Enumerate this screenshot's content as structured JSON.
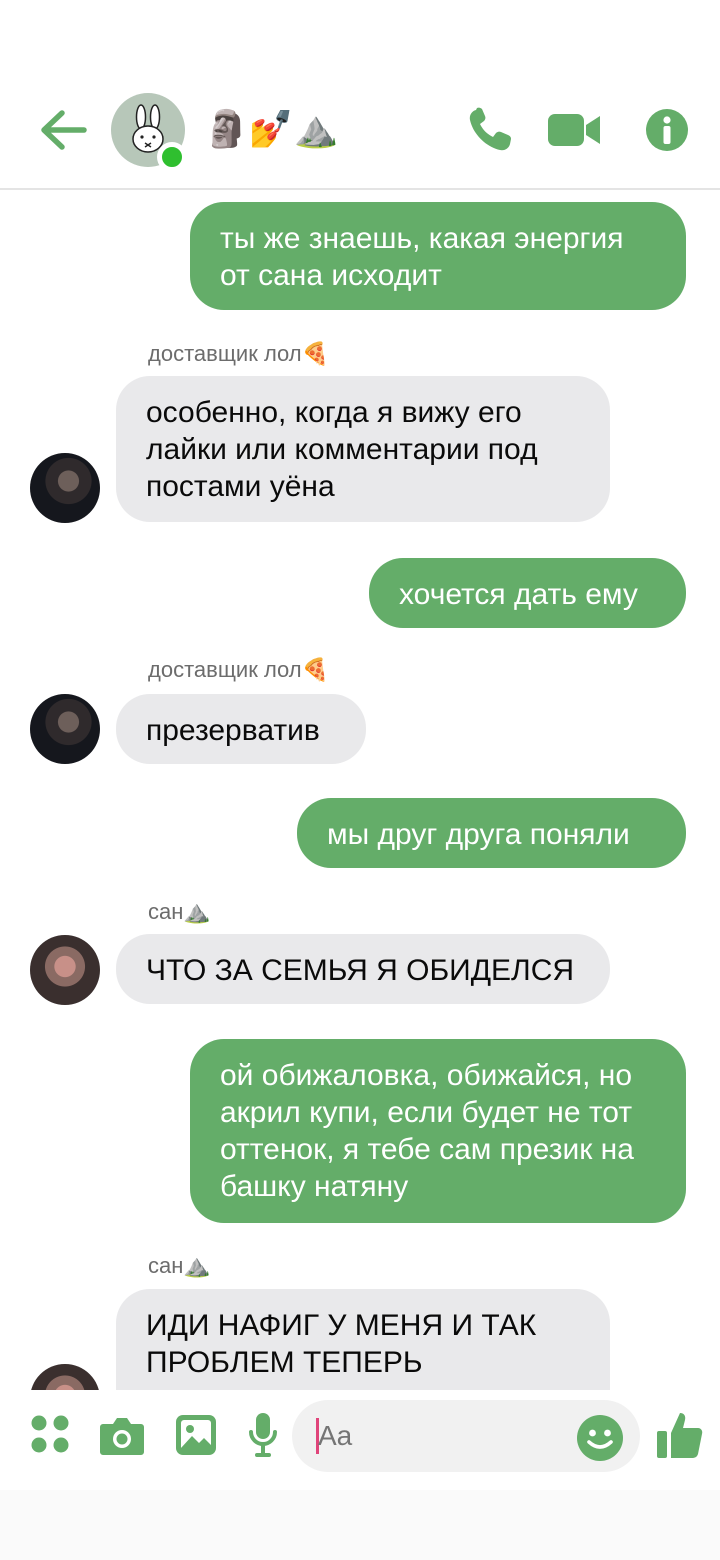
{
  "header": {
    "title": "🗿💅⛰️",
    "back_icon": "arrow-left-icon",
    "call_icon": "phone-icon",
    "video_icon": "video-camera-icon",
    "info_icon": "info-icon",
    "accent_color": "#64ad69"
  },
  "messages": [
    {
      "type": "outgoing",
      "text": "ты же знаешь, какая энергия от сана исходит"
    },
    {
      "type": "incoming",
      "sender": "доставщик лол🍕",
      "text": "особенно, когда я вижу его лайки или комментарии под постами уёна"
    },
    {
      "type": "outgoing",
      "text": "хочется дать ему"
    },
    {
      "type": "incoming",
      "sender": "доставщик лол🍕",
      "text": "презерватив"
    },
    {
      "type": "outgoing",
      "text": "мы друг друга поняли"
    },
    {
      "type": "incoming",
      "sender": "сан⛰️",
      "text": "ЧТО ЗА СЕМЬЯ Я ОБИДЕЛСЯ"
    },
    {
      "type": "outgoing",
      "text": "ой обижаловка, обижайся, но акрил купи, если будет не тот оттенок, я тебе сам презик на башку натяну"
    },
    {
      "type": "incoming",
      "sender": "сан⛰️",
      "text": "ИДИ НАФИГ У МЕНЯ И ТАК ПРОБЛЕМ ТЕПЕРЬ"
    }
  ],
  "composer": {
    "placeholder": "Aa",
    "icons": [
      "apps-icon",
      "camera-icon",
      "image-icon",
      "microphone-icon",
      "emoji-icon",
      "thumbs-up-icon"
    ]
  }
}
